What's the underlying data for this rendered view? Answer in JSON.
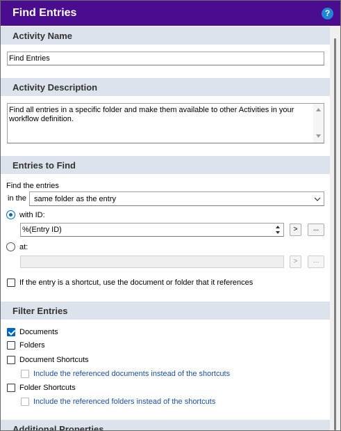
{
  "window": {
    "title": "Find Entries",
    "help_glyph": "?"
  },
  "activity_name": {
    "header": "Activity Name",
    "value": "Find Entries"
  },
  "activity_description": {
    "header": "Activity Description",
    "line1": "Find all entries in a specific folder and make them available to other Activities in your",
    "line2": "workflow definition."
  },
  "entries_to_find": {
    "header": "Entries to Find",
    "find_label": "Find the entries",
    "in_the_label": "in the",
    "folder_select_value": "same folder as the entry",
    "with_id_label": "with ID:",
    "id_value": "%(Entry ID)",
    "at_label": "at:",
    "browse_arrow": ">",
    "browse_dots": "...",
    "shortcut_label": "If the entry is a shortcut, use the document or folder that it references"
  },
  "filter_entries": {
    "header": "Filter Entries",
    "documents": "Documents",
    "folders": "Folders",
    "document_shortcuts": "Document Shortcuts",
    "include_docs": "Include the referenced documents instead of the shortcuts",
    "folder_shortcuts": "Folder Shortcuts",
    "include_folders": "Include the referenced folders instead of the shortcuts"
  },
  "additional_properties": {
    "header": "Additional Properties"
  },
  "colors": {
    "titlebar": "#4b0d8f",
    "section": "#dce3ec",
    "accent": "#0067c0",
    "link": "#1b4f9c"
  }
}
